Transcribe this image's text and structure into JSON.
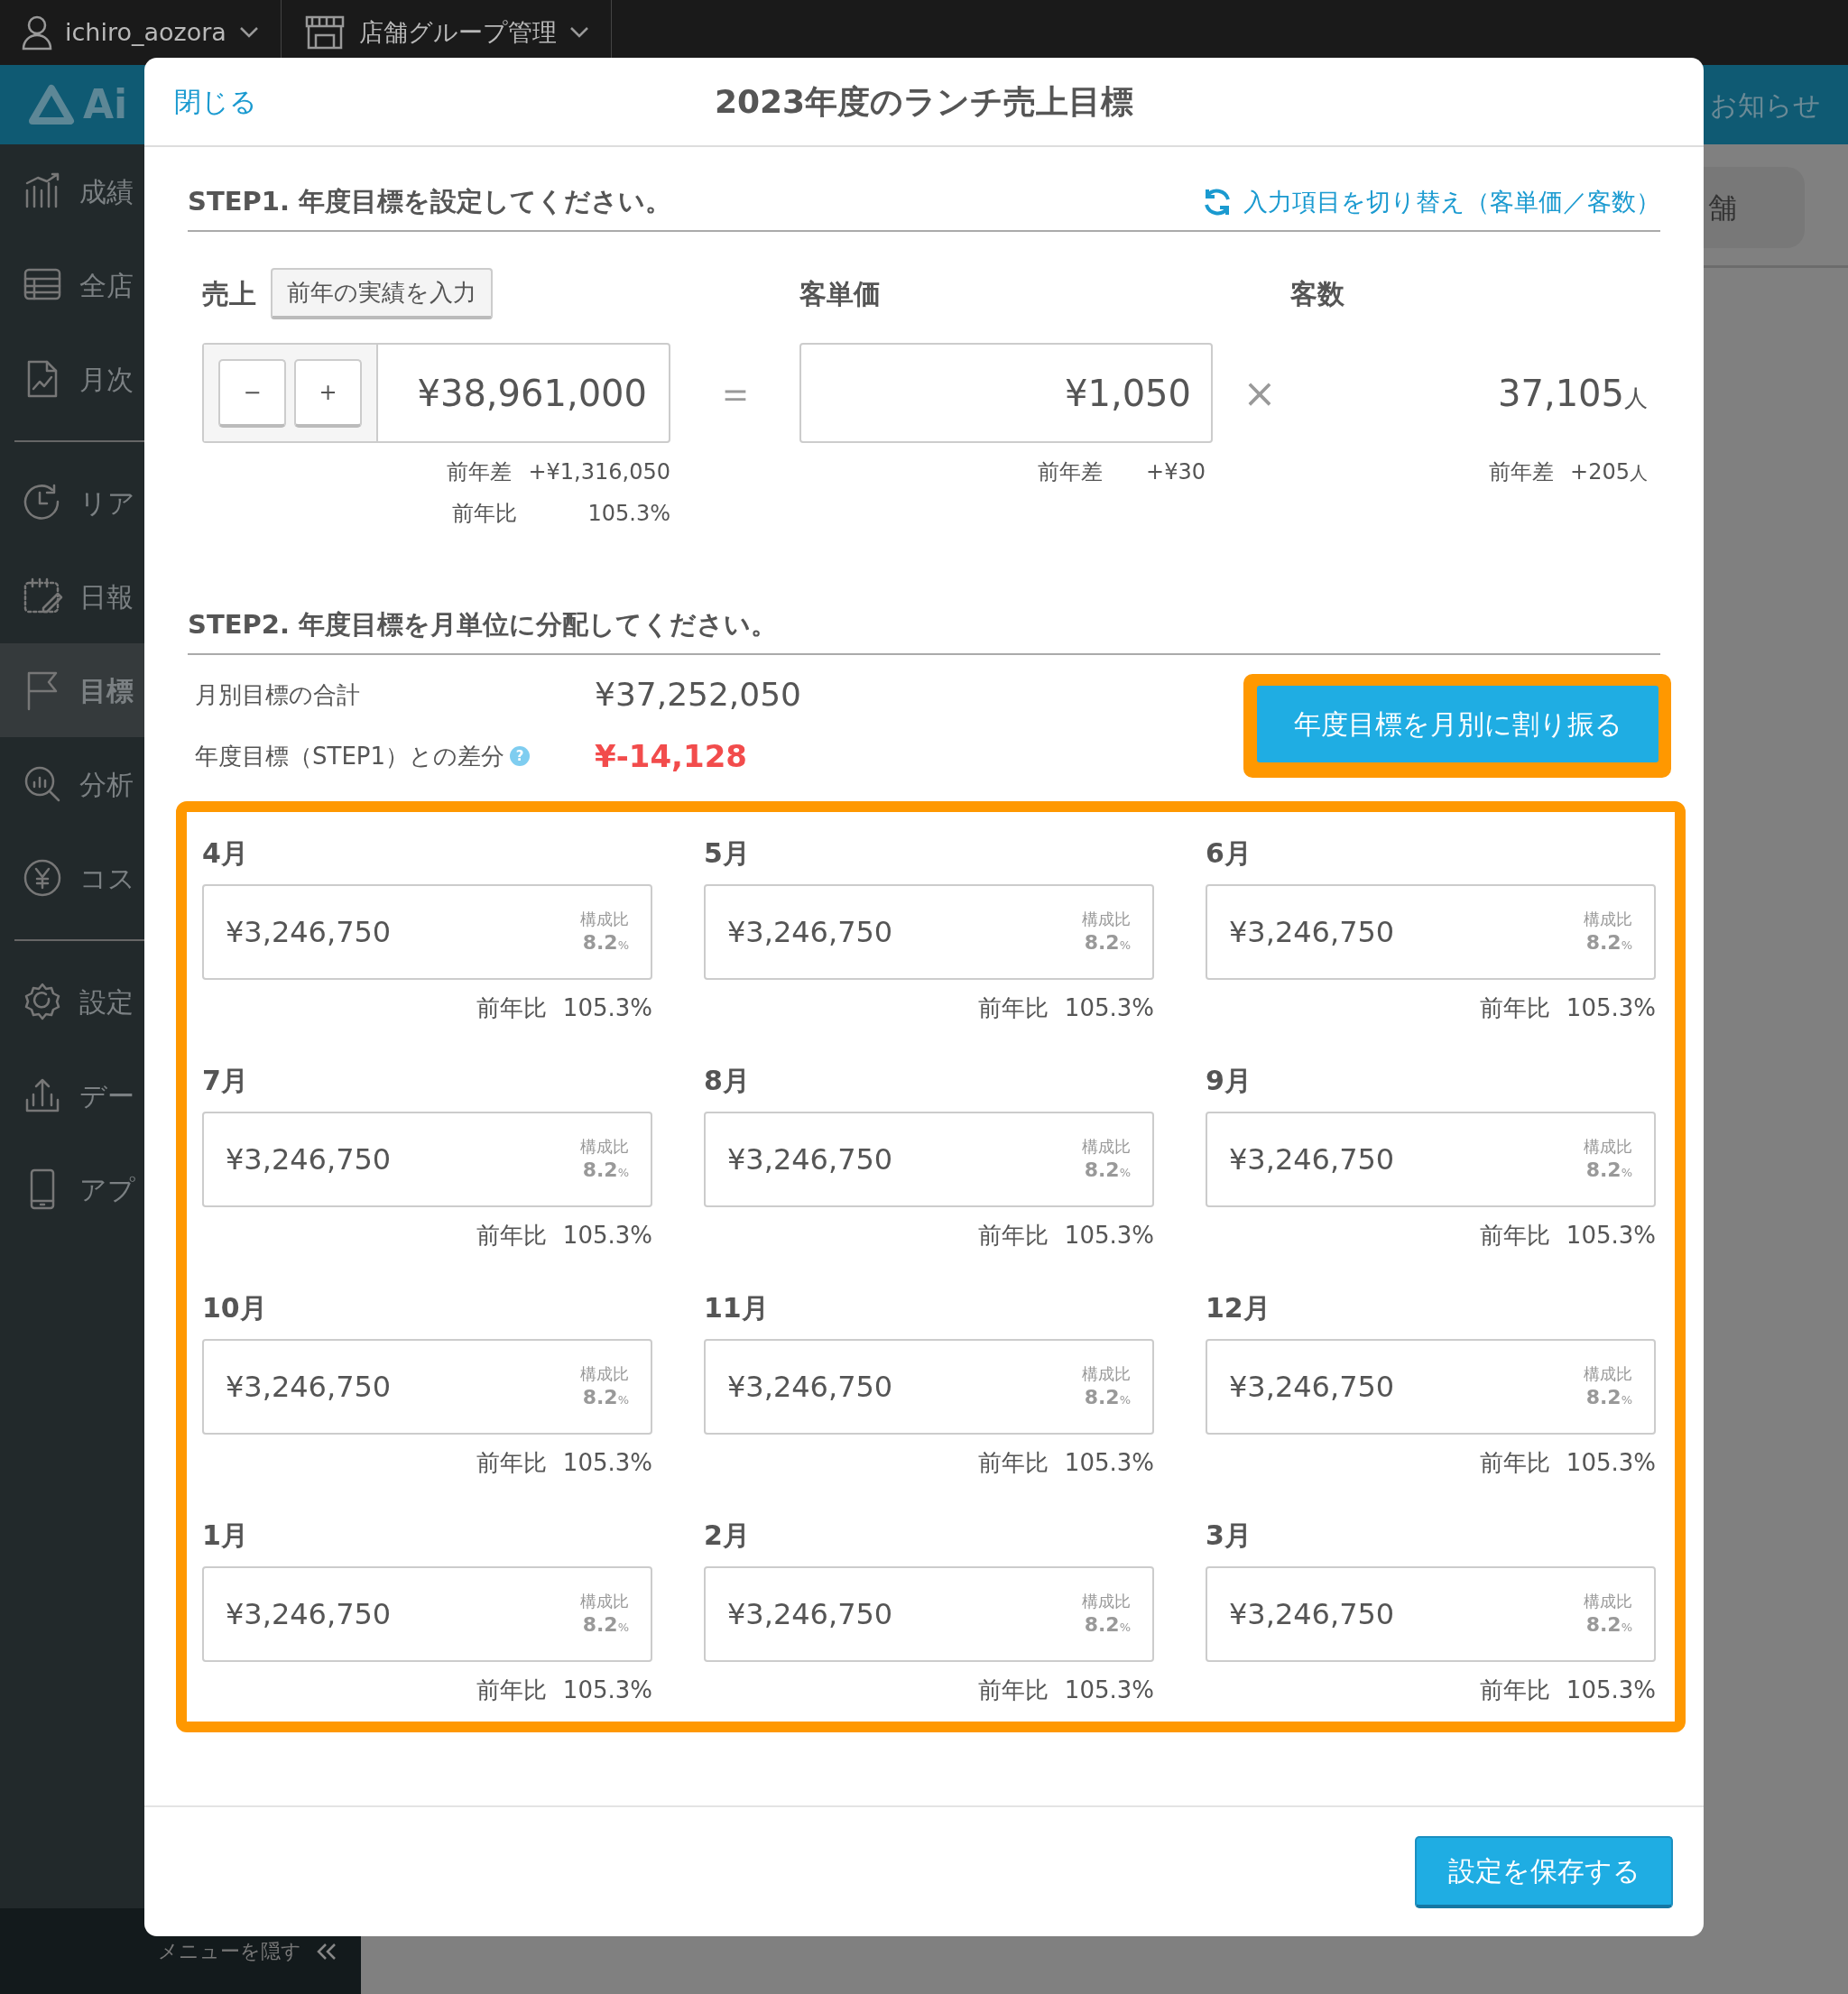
{
  "top_bar": {
    "user": "ichiro_aozora",
    "store_group": "店舗グループ管理"
  },
  "header": {
    "logo": "Ai",
    "notice": "お知らせ",
    "store_tab": "舗"
  },
  "sidebar": {
    "items": [
      {
        "label": "成績",
        "selected": false,
        "divider_after": false
      },
      {
        "label": "全店",
        "selected": false,
        "divider_after": false
      },
      {
        "label": "月次",
        "selected": false,
        "divider_after": true
      },
      {
        "label": "リア",
        "selected": false,
        "divider_after": false
      },
      {
        "label": "日報",
        "selected": false,
        "divider_after": false
      },
      {
        "label": "目標",
        "selected": true,
        "divider_after": false
      },
      {
        "label": "分析",
        "selected": false,
        "divider_after": false
      },
      {
        "label": "コス",
        "selected": false,
        "divider_after": true
      },
      {
        "label": "設定",
        "selected": false,
        "divider_after": false
      },
      {
        "label": "デー",
        "selected": false,
        "divider_after": false
      },
      {
        "label": "アプ",
        "selected": false,
        "divider_after": false
      }
    ],
    "hide_menu": "メニューを隠す"
  },
  "modal": {
    "close": "閉じる",
    "title": "2023年度のランチ売上目標",
    "step1": {
      "heading": "STEP1. 年度目標を設定してください。",
      "toggle_link": "入力項目を切り替え（客単価／客数）",
      "sales": {
        "label": "売上",
        "prev_button": "前年の実績を入力",
        "minus": "−",
        "plus": "+",
        "value": "¥38,961,000",
        "diff_label": "前年差",
        "diff": "+¥1,316,050",
        "ratio_label": "前年比",
        "ratio": "105.3%"
      },
      "equals": "＝",
      "unit_price": {
        "label": "客単価",
        "value": "¥1,050",
        "diff_label": "前年差",
        "diff": "+¥30"
      },
      "times": "×",
      "customers": {
        "label": "客数",
        "value": "37,105",
        "unit": "人",
        "diff_label": "前年差",
        "diff": "+205",
        "diff_unit": "人"
      }
    },
    "step2": {
      "heading": "STEP2. 年度目標を月単位に分配してください。",
      "total_label": "月別目標の合計",
      "total": "¥37,252,050",
      "gap_label": "年度目標（STEP1）との差分",
      "help": "?",
      "gap": "¥-14,128",
      "distribute_button": {
        "label": "年度目標を月別に割り振る",
        "highlighted": true
      },
      "months_highlighted": true,
      "months": [
        {
          "month": "4月",
          "value": "¥3,246,750",
          "share_label": "構成比",
          "share": "8.2",
          "share_unit": "%",
          "ratio_label": "前年比",
          "ratio": "105.3%"
        },
        {
          "month": "5月",
          "value": "¥3,246,750",
          "share_label": "構成比",
          "share": "8.2",
          "share_unit": "%",
          "ratio_label": "前年比",
          "ratio": "105.3%"
        },
        {
          "month": "6月",
          "value": "¥3,246,750",
          "share_label": "構成比",
          "share": "8.2",
          "share_unit": "%",
          "ratio_label": "前年比",
          "ratio": "105.3%"
        },
        {
          "month": "7月",
          "value": "¥3,246,750",
          "share_label": "構成比",
          "share": "8.2",
          "share_unit": "%",
          "ratio_label": "前年比",
          "ratio": "105.3%"
        },
        {
          "month": "8月",
          "value": "¥3,246,750",
          "share_label": "構成比",
          "share": "8.2",
          "share_unit": "%",
          "ratio_label": "前年比",
          "ratio": "105.3%"
        },
        {
          "month": "9月",
          "value": "¥3,246,750",
          "share_label": "構成比",
          "share": "8.2",
          "share_unit": "%",
          "ratio_label": "前年比",
          "ratio": "105.3%"
        },
        {
          "month": "10月",
          "value": "¥3,246,750",
          "share_label": "構成比",
          "share": "8.2",
          "share_unit": "%",
          "ratio_label": "前年比",
          "ratio": "105.3%"
        },
        {
          "month": "11月",
          "value": "¥3,246,750",
          "share_label": "構成比",
          "share": "8.2",
          "share_unit": "%",
          "ratio_label": "前年比",
          "ratio": "105.3%"
        },
        {
          "month": "12月",
          "value": "¥3,246,750",
          "share_label": "構成比",
          "share": "8.2",
          "share_unit": "%",
          "ratio_label": "前年比",
          "ratio": "105.3%"
        },
        {
          "month": "1月",
          "value": "¥3,246,750",
          "share_label": "構成比",
          "share": "8.2",
          "share_unit": "%",
          "ratio_label": "前年比",
          "ratio": "105.3%"
        },
        {
          "month": "2月",
          "value": "¥3,246,750",
          "share_label": "構成比",
          "share": "8.2",
          "share_unit": "%",
          "ratio_label": "前年比",
          "ratio": "105.3%"
        },
        {
          "month": "3月",
          "value": "¥3,246,750",
          "share_label": "構成比",
          "share": "8.2",
          "share_unit": "%",
          "ratio_label": "前年比",
          "ratio": "105.3%"
        }
      ]
    },
    "save_button": "設定を保存する"
  }
}
